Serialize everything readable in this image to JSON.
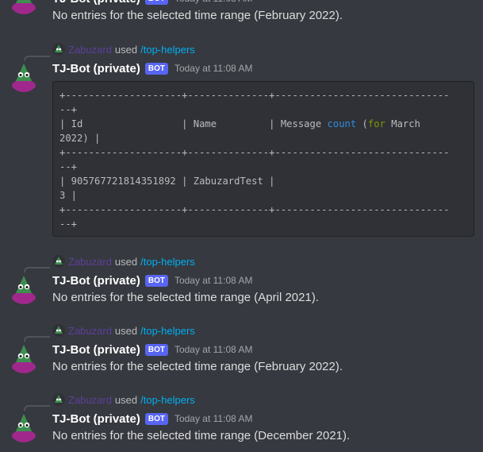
{
  "bot": {
    "name": "TJ-Bot (private)",
    "tag": "BOT",
    "timestamp": "Today at 11:08 AM"
  },
  "reply": {
    "user": "Zabuzard",
    "used": "used",
    "command": "/top-helpers"
  },
  "top_message": {
    "content": "No entries for the selected time range (February 2022)."
  },
  "table_message": {
    "code_lines": [
      "+--------------------+--------------+------------------------------",
      "--+",
      "| Id                 | Name         | Message ",
      "2022) |",
      "+--------------------+--------------+------------------------------",
      "--+",
      "| 905767721814351892 | ZabuzardTest |",
      "3 |",
      "+--------------------+--------------+------------------------------",
      "--+"
    ],
    "header_kw_count": "count",
    "header_kw_open": " (",
    "header_kw_for": "for",
    "header_tail": " March"
  },
  "messages": [
    {
      "content": "No entries for the selected time range (April 2021)."
    },
    {
      "content": "No entries for the selected time range (February 2022)."
    },
    {
      "content": "No entries for the selected time range (December 2021)."
    }
  ],
  "colors": {
    "background": "#36393f",
    "bot_tag": "#5865f2",
    "command_link": "#00aff4",
    "reply_user": "#5d3f9c",
    "code_bg": "#2f3136"
  }
}
